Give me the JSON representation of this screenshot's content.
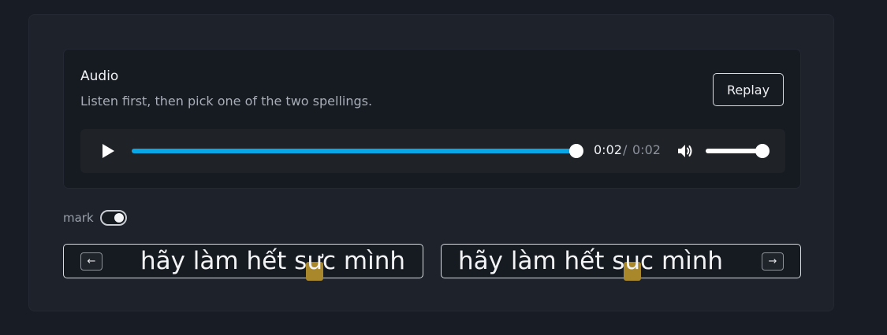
{
  "audio": {
    "title": "Audio",
    "subtitle": "Listen first, then pick one of the two spellings.",
    "replay_label": "Replay"
  },
  "player": {
    "play_icon": "play-icon",
    "current_time": "0:02",
    "separator": "/",
    "total_time": "0:02",
    "progress_percent": 100,
    "volume_icon": "volume-icon",
    "volume_percent": 100,
    "accent_color": "#0aa7e6"
  },
  "mark": {
    "label": "mark",
    "enabled": true
  },
  "choices": [
    {
      "key_label": "←",
      "before": "hãy làm hết s",
      "highlight": "ư",
      "after": "c mình"
    },
    {
      "key_label": "→",
      "before": "hãy làm hết s",
      "highlight": "u",
      "after": "c mình"
    }
  ],
  "highlight_color": "#a8882a"
}
